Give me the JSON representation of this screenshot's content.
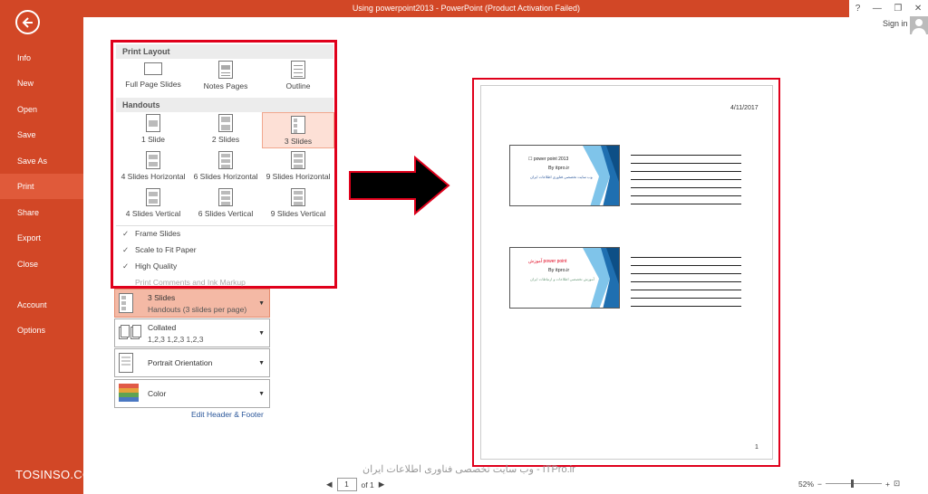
{
  "window": {
    "title": "Using powerpoint2013 -  PowerPoint (Product Activation Failed)",
    "help": "?",
    "minimize": "—",
    "restore": "❐",
    "close": "✕",
    "signin": "Sign in"
  },
  "nav": {
    "items": [
      "Info",
      "New",
      "Open",
      "Save",
      "Save As",
      "Print",
      "Share",
      "Export",
      "Close",
      "Account",
      "Options"
    ],
    "active": "Print",
    "watermark": "TOSINSO.COM"
  },
  "panel": {
    "print_layout_head": "Print Layout",
    "layouts": [
      "Full Page Slides",
      "Notes Pages",
      "Outline"
    ],
    "handouts_head": "Handouts",
    "handouts": [
      "1 Slide",
      "2 Slides",
      "3 Slides",
      "4 Slides Horizontal",
      "6 Slides Horizontal",
      "9 Slides Horizontal",
      "4 Slides Vertical",
      "6 Slides Vertical",
      "9 Slides Vertical"
    ],
    "selected": "3 Slides",
    "checks": [
      {
        "label": "Frame Slides",
        "checked": true
      },
      {
        "label": "Scale to Fit Paper",
        "checked": true
      },
      {
        "label": "High Quality",
        "checked": true
      },
      {
        "label": "Print Comments and Ink Markup",
        "checked": false
      }
    ]
  },
  "settings": {
    "layout": {
      "title": "3 Slides",
      "sub": "Handouts (3 slides per page)"
    },
    "collate": {
      "title": "Collated",
      "sub": "1,2,3    1,2,3    1,2,3"
    },
    "orientation": {
      "title": "Portrait Orientation"
    },
    "color": {
      "title": "Color"
    },
    "edit_link": "Edit Header & Footer"
  },
  "preview": {
    "date": "4/11/2017",
    "page_number": "1",
    "slide1": {
      "title": "☐ power point 2013",
      "by": "By itpro.ir",
      "sub": "وب سایت تخصصی فناوری اطلاعات ایران"
    },
    "slide2": {
      "title": "آموزش power point",
      "by": "By itpro.ir",
      "sub": "آموزش تخصصی اطلاعات و ارتباطات ایران"
    }
  },
  "status": {
    "page": "1",
    "of": "of 1",
    "watermark": "وب سایت تخصصی فناوری اطلاعات ایران - ITPro.ir",
    "zoom": "52%"
  },
  "colors": {
    "accent": "#d24726",
    "highlight": "#e0001b"
  }
}
